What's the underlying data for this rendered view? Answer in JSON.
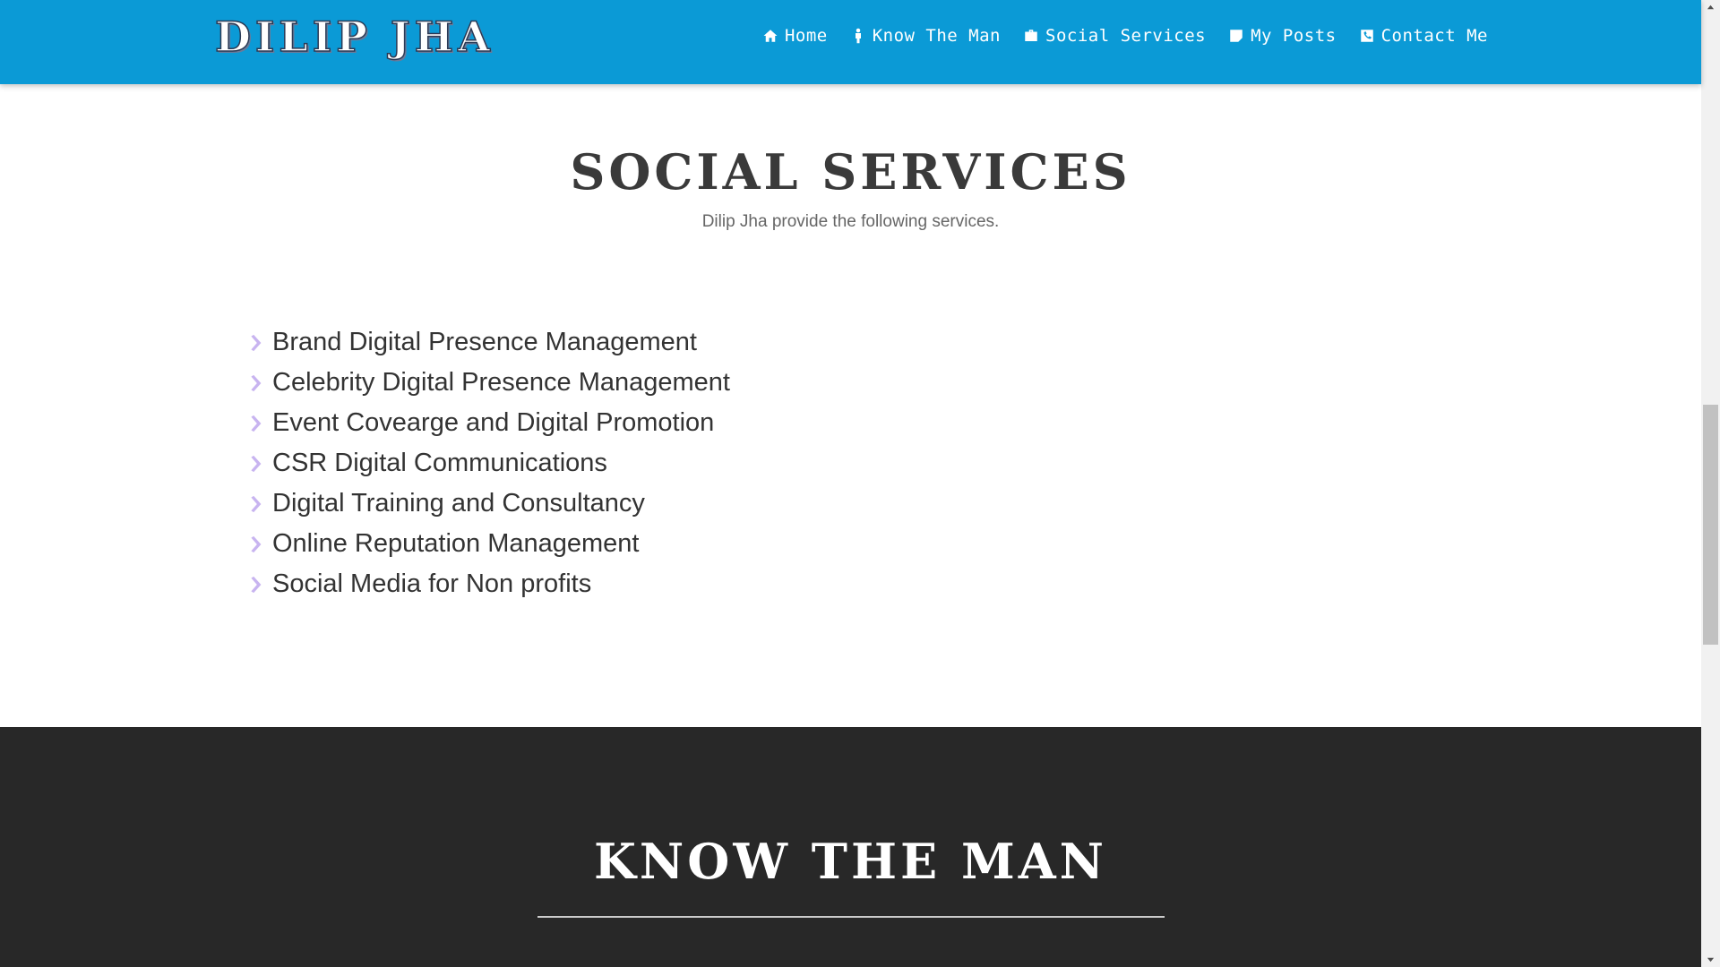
{
  "header": {
    "brand": "DILIP JHA",
    "nav": [
      {
        "label": "Home",
        "icon": "home-icon"
      },
      {
        "label": "Know The Man",
        "icon": "person-icon"
      },
      {
        "label": "Social Services",
        "icon": "briefcase-icon"
      },
      {
        "label": "My Posts",
        "icon": "note-icon"
      },
      {
        "label": "Contact Me",
        "icon": "phone-icon"
      }
    ]
  },
  "services_section": {
    "title": "SOCIAL SERVICES",
    "subtitle": "Dilip Jha provide the following services.",
    "items": [
      "Brand Digital Presence Management",
      "Celebrity Digital Presence Management",
      "Event Covearge and Digital Promotion",
      "CSR Digital Communications",
      "Digital Training and Consultancy",
      "Online Reputation Management",
      "Social Media for Non profits"
    ]
  },
  "know_section": {
    "title": "KNOW THE MAN"
  },
  "colors": {
    "navbar": "#0b9ad6",
    "bullet": "#c8b4f0",
    "dark_section": "#282828"
  }
}
